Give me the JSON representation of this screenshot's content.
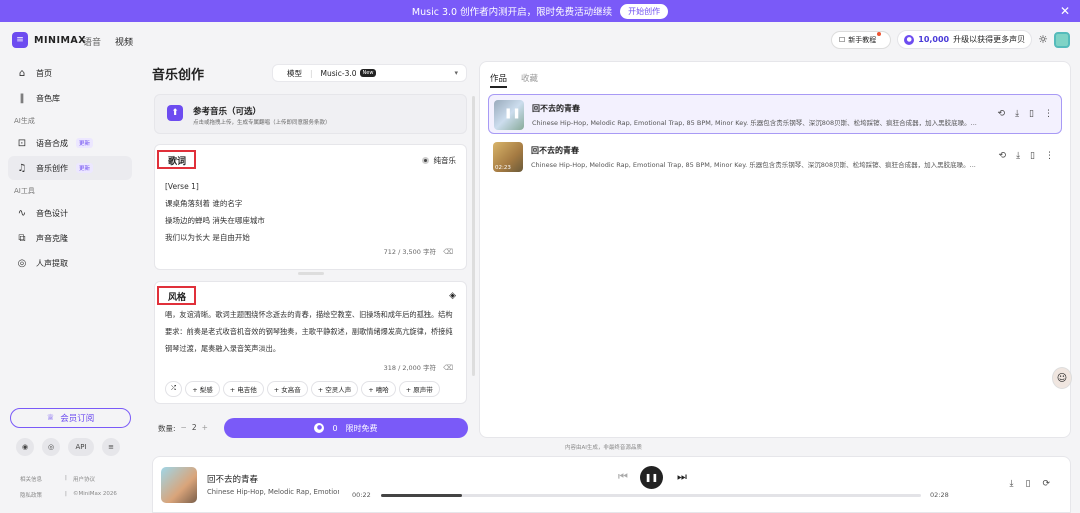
{
  "banner": {
    "text": "Music 3.0 创作者内测开启，限时免费活动继续",
    "button": "开始创作"
  },
  "brand": {
    "logo_text": "MINIMAX",
    "nav": [
      "语音",
      "视频"
    ]
  },
  "header": {
    "tutorial": "新手教程",
    "credits": "10,000",
    "upgrade": "升级以获得更多声贝"
  },
  "sidebar": {
    "top": [
      {
        "label": "首页"
      },
      {
        "label": "音色库"
      }
    ],
    "section_ai": "AI生成",
    "ai_items": [
      {
        "label": "语音合成",
        "badge": "更新"
      },
      {
        "label": "音乐创作",
        "badge": "更新"
      }
    ],
    "section_tools": "AI工具",
    "tool_items": [
      {
        "label": "音色设计"
      },
      {
        "label": "声音克隆"
      },
      {
        "label": "人声提取"
      }
    ],
    "member": "会员订阅",
    "api": "API",
    "footer": [
      "相关信息",
      "用户协议",
      "隐私政策",
      "©MiniMax 2026"
    ]
  },
  "create": {
    "title": "音乐创作",
    "model_label": "模型",
    "model_value": "Music-3.0",
    "model_badge": "New",
    "ref_title": "参考音乐（可选）",
    "ref_sub": "点击或拖拽上传，生成专属翻唱（上传即同意服务条款）",
    "lyrics_label": "歌词",
    "pure_music": "纯音乐",
    "lyrics": [
      "[Verse 1]",
      "课桌角落刻着 谁的名字",
      "操场边的蝉鸣 消失在哪座城市",
      "我们以为长大 是自由开始"
    ],
    "lyrics_count": "712 / 3,500 字符",
    "style_label": "风格",
    "style_desc": "唱，友谊清晰。歌词主题围绕怀念逝去的青春，描绘空教室、旧操场和成年后的孤独。结构要求：前奏是老式收音机音效的钢琴独奏，主歌平静叙述，副歌情绪爆发高亢旋律，桥接纯钢琴过渡，尾奏融入录音笑声淡出。",
    "style_count": "318 / 2,000 字符",
    "tags": [
      "梨感",
      "电吉他",
      "女高音",
      "空灵人声",
      "嘻哈",
      "原声带"
    ],
    "qty_label": "数量:",
    "qty_minus": "−",
    "qty_value": "2",
    "qty_plus": "+",
    "gen_cost": "0",
    "gen_label": "限时免费"
  },
  "works": {
    "tabs": [
      "作品",
      "收藏"
    ],
    "tracks": [
      {
        "title": "回不去的青春",
        "desc": "Chinese Hip-Hop, Melodic Rap, Emotional Trap, 85 BPM, Minor Key. 乐器包含贵乐钢琴、深沉808贝斯、松垮踩镲、疯狂合成器，加入黑胶底噪。...",
        "duration": ""
      },
      {
        "title": "回不去的青春",
        "desc": "Chinese Hip-Hop, Melodic Rap, Emotional Trap, 85 BPM, Minor Key. 乐器包含贵乐钢琴、深沉808贝斯、松垮踩镲、疯狂合成器，加入黑胶底噪。...",
        "duration": "02:23"
      }
    ]
  },
  "disclaimer": "内容由AI生成，非最终音源品质",
  "player": {
    "title": "回不去的青春",
    "sub": "Chinese Hip-Hop, Melodic Rap, Emotional Trap",
    "current": "00:22",
    "total": "02:28",
    "progress": 0.15
  }
}
